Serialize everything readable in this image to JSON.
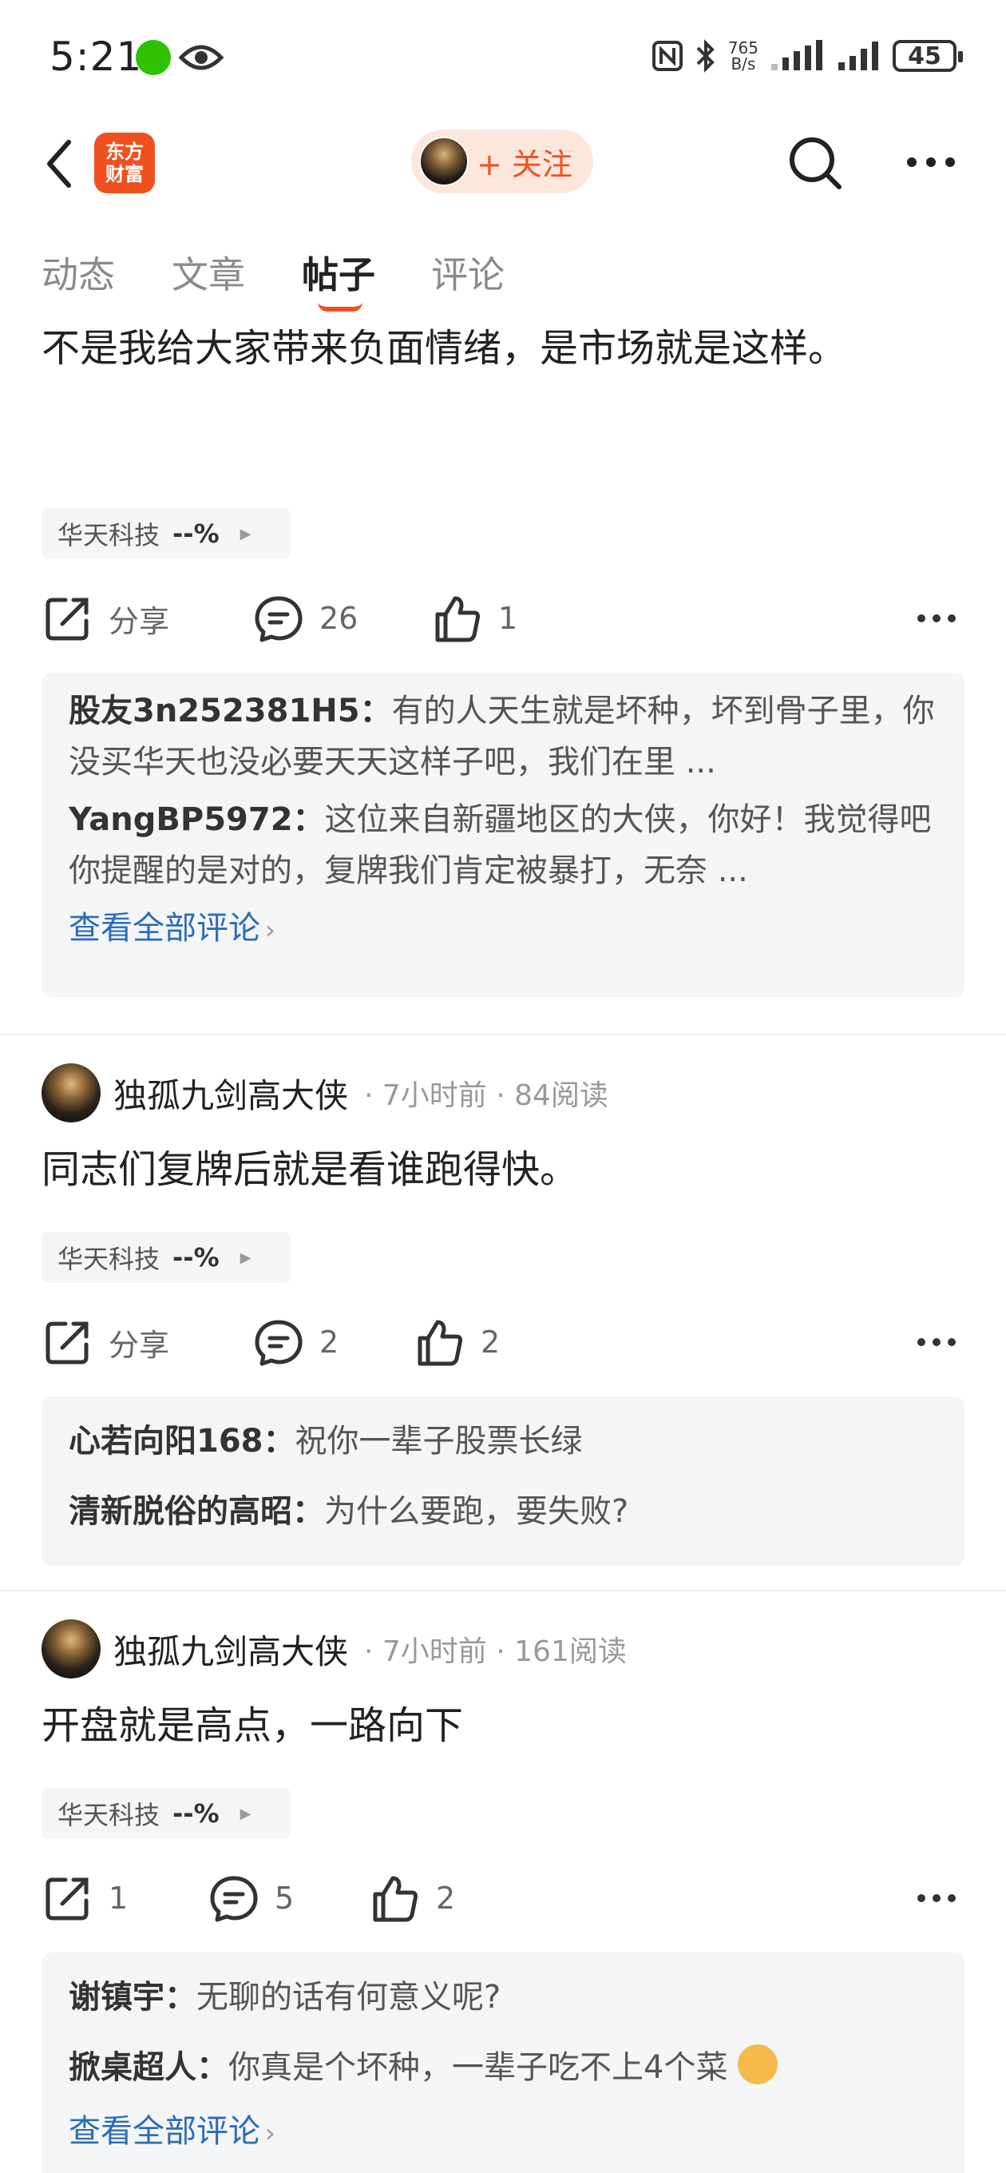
{
  "status_bar": {
    "time": "5:21",
    "net_speed_value": "765",
    "net_speed_unit": "B/s",
    "battery": "45"
  },
  "header": {
    "logo_line1": "东方",
    "logo_line2": "财富",
    "follow_label": "+ 关注"
  },
  "tabs": [
    {
      "label": "动态"
    },
    {
      "label": "文章"
    },
    {
      "label": "帖子"
    },
    {
      "label": "评论"
    }
  ],
  "active_tab": "帖子",
  "posts": [
    {
      "text": "同志们复牌就是挨打的时候，而且是毒打。拭目以待。不是我给大家带来负面情绪，是市场就是这样。",
      "stock": {
        "name": "华天科技",
        "pct": "--%"
      },
      "share_label": "分享",
      "comments": "26",
      "likes": "1",
      "replies": [
        {
          "user": "股友3n252381H5",
          "text": "有的人天生就是坏种，坏到骨子里，你没买华天也没必要天天这样子吧，我们在里 ..."
        },
        {
          "user": "YangBP5972",
          "text": "这位来自新疆地区的大侠，你好！我觉得吧你提醒的是对的，复牌我们肯定被暴打，无奈 ..."
        }
      ],
      "view_all": "查看全部评论"
    },
    {
      "author": "独孤九剑高大侠",
      "time": "7小时前",
      "reads": "84阅读",
      "text": "同志们复牌后就是看谁跑得快。",
      "stock": {
        "name": "华天科技",
        "pct": "--%"
      },
      "share_label": "分享",
      "comments": "2",
      "likes": "2",
      "replies": [
        {
          "user": "心若向阳168",
          "text": "祝你一辈子股票长绿"
        },
        {
          "user": "清新脱俗的高昭",
          "text": "为什么要跑，要失败?"
        }
      ]
    },
    {
      "author": "独孤九剑高大侠",
      "time": "7小时前",
      "reads": "161阅读",
      "text": "开盘就是高点，一路向下",
      "stock": {
        "name": "华天科技",
        "pct": "--%"
      },
      "share_count": "1",
      "comments": "5",
      "likes": "2",
      "replies": [
        {
          "user": "谢镇宇",
          "text": "无聊的话有何意义呢?"
        },
        {
          "user": "掀桌超人",
          "text": "你真是个坏种，一辈子吃不上4个菜"
        }
      ],
      "view_all": "查看全部评论"
    }
  ],
  "colors": {
    "accent": "#f0501e",
    "link": "#2a6db8",
    "wechat": "#2dc100"
  },
  "icons": [
    "back-icon",
    "search-icon",
    "more-icon",
    "share-icon",
    "comment-icon",
    "like-icon",
    "eye-icon",
    "wechat-icon",
    "nfc-icon",
    "bluetooth-icon",
    "signal-icon",
    "battery-icon"
  ]
}
